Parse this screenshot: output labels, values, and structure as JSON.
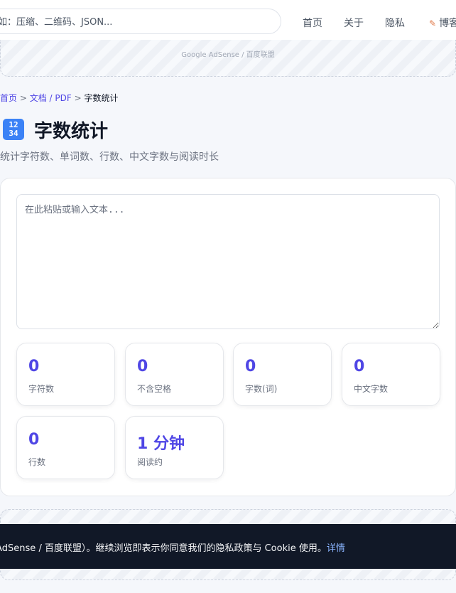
{
  "header": {
    "search_placeholder": "如：压缩、二维码、JSON...",
    "nav": [
      "首页",
      "关于",
      "隐私",
      "博客"
    ],
    "blog_icon": "memo-icon"
  },
  "ads": {
    "top_label": "Google AdSense / 百度联盟"
  },
  "breadcrumb": {
    "home": "首页",
    "sep": ">",
    "docs": "文档 / PDF",
    "current": "字数统计"
  },
  "page": {
    "icon_glyph": "1234",
    "icon_rows": [
      "12",
      "34"
    ],
    "title": "字数统计",
    "subtitle": "统计字符数、单词数、行数、中文字数与阅读时长"
  },
  "editor": {
    "placeholder": "在此粘贴或输入文本...",
    "value": ""
  },
  "stats": [
    {
      "value": "0",
      "label": "字符数"
    },
    {
      "value": "0",
      "label": "不含空格"
    },
    {
      "value": "0",
      "label": "字数(词)"
    },
    {
      "value": "0",
      "label": "中文字数"
    },
    {
      "value": "0",
      "label": "行数"
    },
    {
      "value": "1 分钟",
      "label": "阅读约"
    }
  ],
  "cookie": {
    "message": "e AdSense / 百度联盟）。继续浏览即表示你同意我们的隐私政策与 Cookie 使用。",
    "link": "详情"
  },
  "colors": {
    "accent": "#4f46e5",
    "banner_bg": "#111827",
    "link_in_banner": "#8ab4ff"
  }
}
